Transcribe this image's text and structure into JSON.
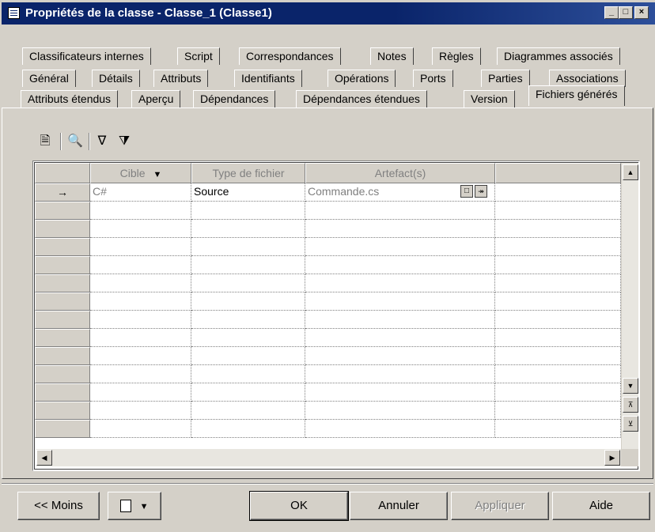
{
  "window": {
    "title": "Propriétés de la classe - Classe_1 (Classe1)",
    "min_glyph": "_",
    "max_glyph": "□",
    "close_glyph": "×"
  },
  "tabs": {
    "row1": [
      "Classificateurs internes",
      "Script",
      "Correspondances",
      "Notes",
      "Règles",
      "Diagrammes associés"
    ],
    "row2": [
      "Général",
      "Détails",
      "Attributs",
      "Identifiants",
      "Opérations",
      "Ports",
      "Parties",
      "Associations"
    ],
    "row3": [
      "Attributs étendus",
      "Aperçu",
      "Dépendances",
      "Dépendances étendues",
      "Version",
      "Fichiers générés"
    ],
    "active": "Fichiers générés"
  },
  "toolbar": {
    "properties_icon": "properties-icon",
    "find_icon": "binoculars-icon",
    "filter_icon": "filter-icon",
    "filter_clear_icon": "filter-clear-icon"
  },
  "grid": {
    "columns": [
      "Cible",
      "Type de fichier",
      "Artefact(s)",
      ""
    ],
    "rows": [
      {
        "marker": "→",
        "cible": "C#",
        "type": "Source",
        "artefact": "Commande.cs"
      }
    ],
    "empty_rows": 13
  },
  "buttons": {
    "less": "<< Moins",
    "ok": "OK",
    "cancel": "Annuler",
    "apply": "Appliquer",
    "help": "Aide"
  }
}
